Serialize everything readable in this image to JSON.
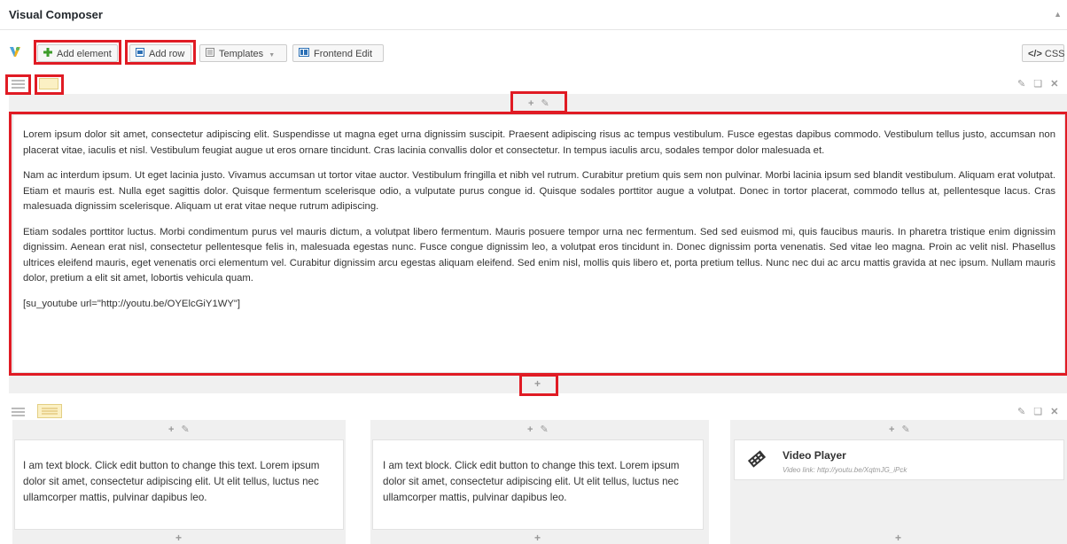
{
  "panel": {
    "title": "Visual Composer"
  },
  "toolbar": {
    "add_element": "Add element",
    "add_row": "Add row",
    "templates": "Templates",
    "frontend_edit": "Frontend Edit",
    "css": "CSS"
  },
  "row1": {
    "paragraphs": [
      "Lorem ipsum dolor sit amet, consectetur adipiscing elit. Suspendisse ut magna eget urna dignissim suscipit. Praesent adipiscing risus ac tempus vestibulum. Fusce egestas dapibus commodo. Vestibulum tellus justo, accumsan non placerat vitae, iaculis et nisl. Vestibulum feugiat augue ut eros ornare tincidunt. Cras lacinia convallis dolor et consectetur. In tempus iaculis arcu, sodales tempor dolor malesuada et.",
      "Nam ac interdum ipsum. Ut eget lacinia justo. Vivamus accumsan ut tortor vitae auctor. Vestibulum fringilla et nibh vel rutrum. Curabitur pretium quis sem non pulvinar. Morbi lacinia ipsum sed blandit vestibulum. Aliquam erat volutpat. Etiam et mauris est. Nulla eget sagittis dolor. Quisque fermentum scelerisque odio, a vulputate purus congue id. Quisque sodales porttitor augue a volutpat. Donec in tortor placerat, commodo tellus at, pellentesque lacus. Cras malesuada dignissim scelerisque. Aliquam ut erat vitae neque rutrum adipiscing.",
      "Etiam sodales porttitor luctus. Morbi condimentum purus vel mauris dictum, a volutpat libero fermentum. Mauris posuere tempor urna nec fermentum. Sed sed euismod mi, quis faucibus mauris. In pharetra tristique enim dignissim dignissim. Aenean erat nisl, consectetur pellentesque felis in, malesuada egestas nunc. Fusce congue dignissim leo, a volutpat eros tincidunt in. Donec dignissim porta venenatis. Sed vitae leo magna. Proin ac velit nisl. Phasellus ultrices eleifend mauris, eget venenatis orci elementum vel. Curabitur dignissim arcu egestas aliquam eleifend. Sed enim nisl, mollis quis libero et, porta pretium tellus. Nunc nec dui ac arcu mattis gravida at nec ipsum. Nullam mauris dolor, pretium a elit sit amet, lobortis vehicula quam.",
      "[su_youtube url=\"http://youtu.be/OYElcGiY1WY\"]"
    ]
  },
  "row2": {
    "col1_text": "I am text block. Click edit button to change this text. Lorem ipsum dolor sit amet, consectetur adipiscing elit. Ut elit tellus, luctus nec ullamcorper mattis, pulvinar dapibus leo.",
    "col2_text": "I am text block. Click edit button to change this text. Lorem ipsum dolor sit amet, consectetur adipiscing elit. Ut elit tellus, luctus nec ullamcorper mattis, pulvinar dapibus leo.",
    "video_title": "Video Player",
    "video_link": "Video link: http://youtu.be/XqtmJG_iPck"
  },
  "icons": {
    "logo": "vc-logo-icon",
    "add": "plus-icon",
    "edit": "pencil-icon",
    "clone": "clone-icon",
    "delete": "close-icon",
    "layout": "row-layout-icon",
    "video": "film-icon"
  },
  "colors": {
    "highlight": "#e01b24",
    "add_green": "#3c9c2a",
    "accent_blue": "#2a6fb5"
  }
}
